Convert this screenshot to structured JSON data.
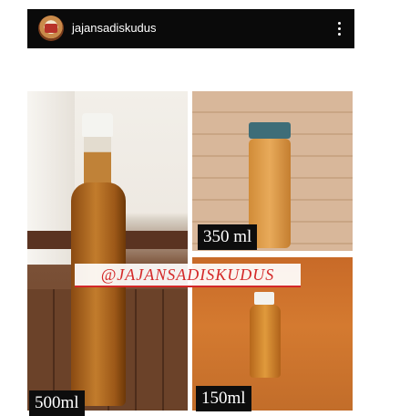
{
  "post": {
    "username": "jajansadiskudus",
    "avatar_icon": "shop-logo-avatar",
    "menu_icon": "more-vertical-icon"
  },
  "photo": {
    "watermark": "@JAJANSADISKUDUS",
    "labels": {
      "left": "500ml",
      "top_right": "350 ml",
      "bottom_right": "150ml"
    }
  },
  "colors": {
    "header_bg": "#0a0a0a",
    "watermark_red": "#d42828"
  }
}
